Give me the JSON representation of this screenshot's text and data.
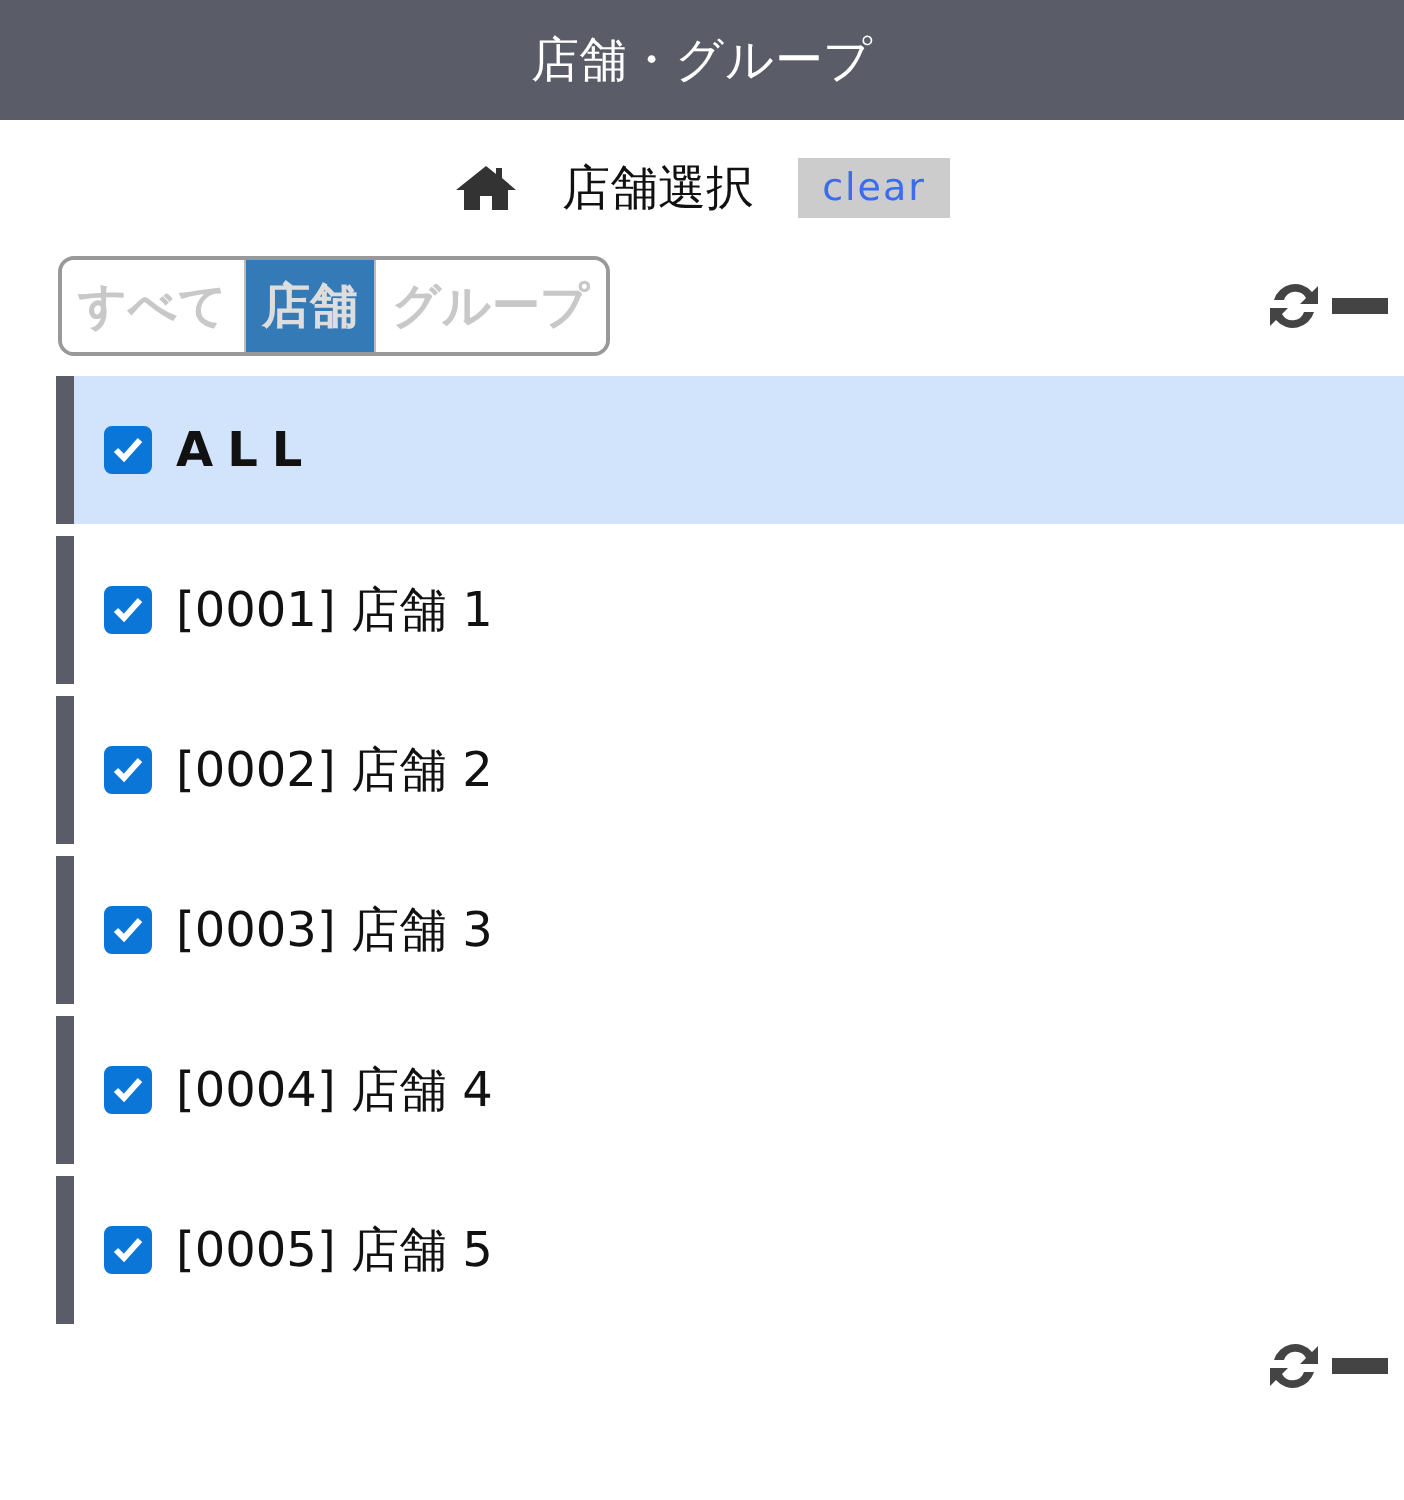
{
  "header": {
    "title": "店舗・グループ"
  },
  "title_row": {
    "label": "店舗選択",
    "clear_button": "clear"
  },
  "tabs": [
    {
      "label": "すべて",
      "selected": false
    },
    {
      "label": "店舗",
      "selected": true
    },
    {
      "label": "グループ",
      "selected": false
    }
  ],
  "items": [
    {
      "kind": "all",
      "label": "ALL",
      "checked": true,
      "selected": true
    },
    {
      "kind": "store",
      "label": "[0001] 店舗 1",
      "checked": true,
      "selected": false
    },
    {
      "kind": "store",
      "label": "[0002] 店舗 2",
      "checked": true,
      "selected": false
    },
    {
      "kind": "store",
      "label": "[0003] 店舗 3",
      "checked": true,
      "selected": false
    },
    {
      "kind": "store",
      "label": "[0004] 店舗 4",
      "checked": true,
      "selected": false
    },
    {
      "kind": "store",
      "label": "[0005] 店舗 5",
      "checked": true,
      "selected": false
    }
  ]
}
